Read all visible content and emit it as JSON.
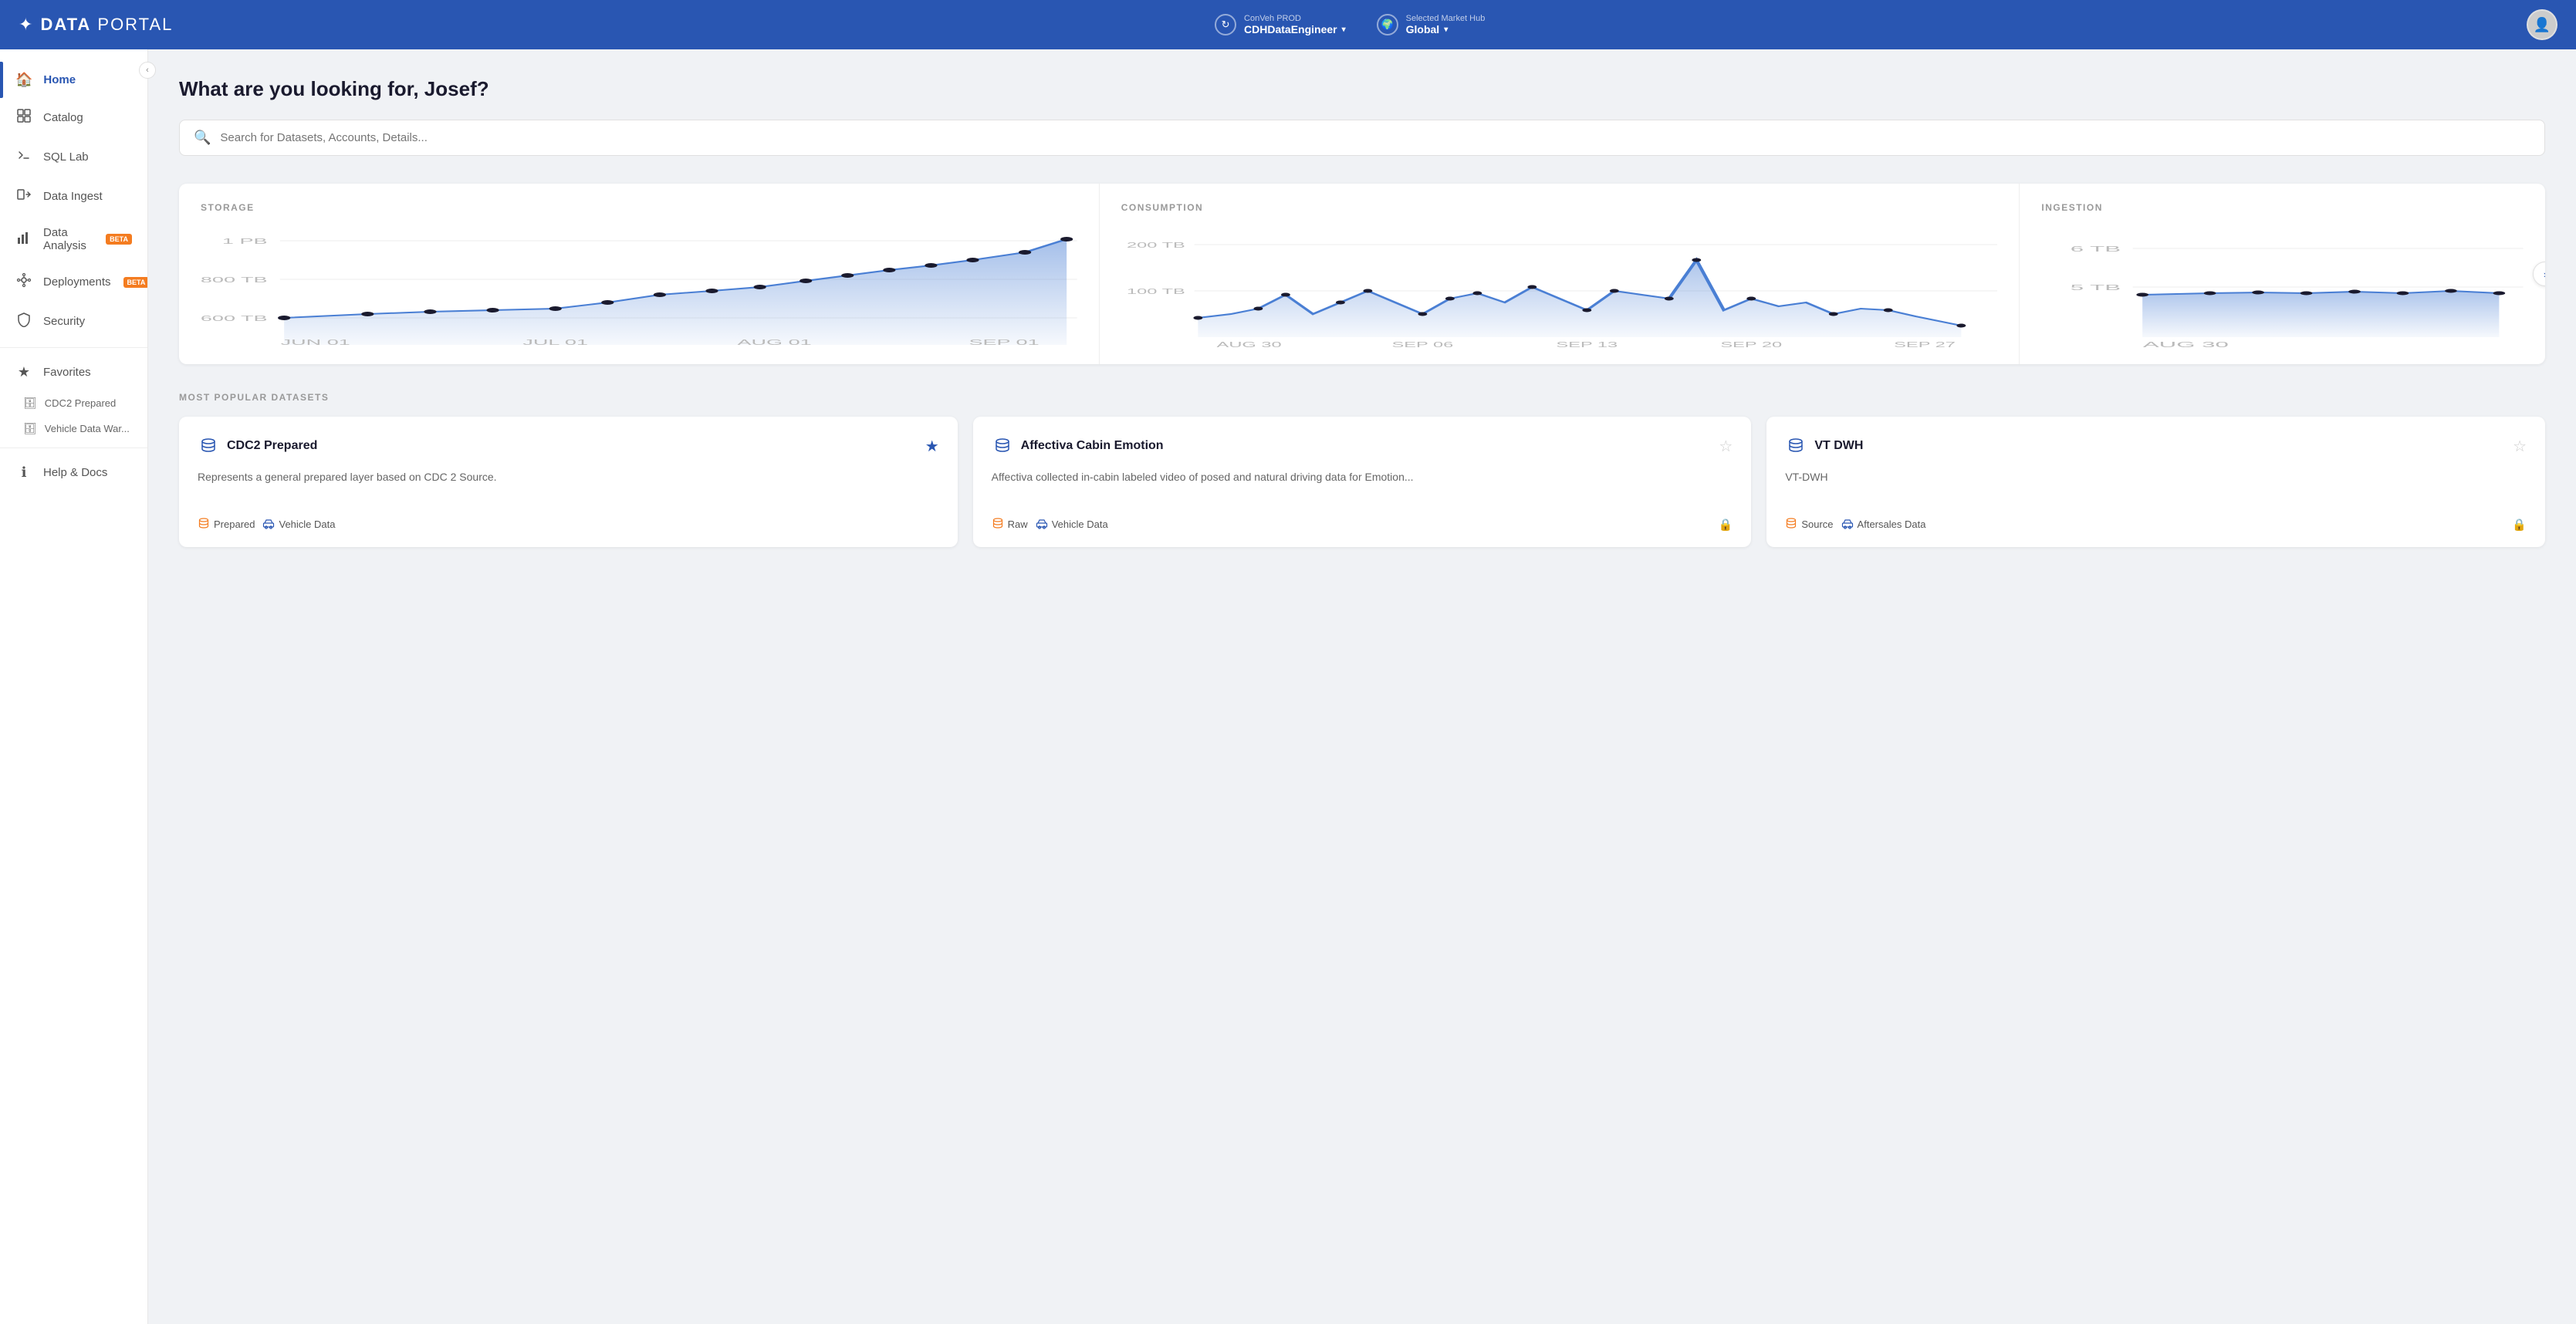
{
  "header": {
    "logo_bold": "DATA",
    "logo_thin": " PORTAL",
    "env": {
      "label": "ConVeh PROD",
      "value": "CDHDataEngineer"
    },
    "market": {
      "label": "Selected Market Hub",
      "value": "Global"
    }
  },
  "sidebar": {
    "collapse_icon": "‹",
    "items": [
      {
        "id": "home",
        "label": "Home",
        "icon": "🏠",
        "active": true,
        "badge": null
      },
      {
        "id": "catalog",
        "label": "Catalog",
        "icon": "⊞",
        "active": false,
        "badge": null
      },
      {
        "id": "sql-lab",
        "label": "SQL Lab",
        "icon": "⚡",
        "active": false,
        "badge": null
      },
      {
        "id": "data-ingest",
        "label": "Data Ingest",
        "icon": "→⊡",
        "active": false,
        "badge": null
      },
      {
        "id": "data-analysis",
        "label": "Data Analysis",
        "icon": "📊",
        "active": false,
        "badge": "BETA"
      },
      {
        "id": "deployments",
        "label": "Deployments",
        "icon": "🔧",
        "active": false,
        "badge": "BETA"
      },
      {
        "id": "security",
        "label": "Security",
        "icon": "🛡",
        "active": false,
        "badge": null
      }
    ],
    "favorites_label": "Favorites",
    "favorites_icon": "★",
    "favorites_items": [
      {
        "id": "cdc2",
        "label": "CDC2 Prepared",
        "icon": "🗄"
      },
      {
        "id": "vehicle",
        "label": "Vehicle Data War...",
        "icon": "🗄"
      }
    ],
    "help_label": "Help & Docs",
    "help_icon": "ℹ"
  },
  "main": {
    "heading": "What are you looking for, Josef?",
    "search_placeholder": "Search for Datasets, Accounts, Details...",
    "charts": {
      "storage": {
        "title": "STORAGE",
        "y_labels": [
          "1 PB",
          "800 TB",
          "600 TB"
        ],
        "x_labels": [
          "JUN 01",
          "JUL 01",
          "AUG 01",
          "SEP 01"
        ]
      },
      "consumption": {
        "title": "CONSUMPTION",
        "y_labels": [
          "200 TB",
          "100 TB"
        ],
        "x_labels": [
          "AUG 30",
          "SEP 06",
          "SEP 13",
          "SEP 20",
          "SEP 27"
        ]
      },
      "ingestion": {
        "title": "INGESTION",
        "y_labels": [
          "6 TB",
          "5 TB"
        ],
        "x_labels": [
          "AUG 30"
        ]
      }
    },
    "datasets_section_title": "MOST POPULAR DATASETS",
    "datasets": [
      {
        "id": "cdc2",
        "name": "CDC2 Prepared",
        "icon": "🗄",
        "description": "Represents a general prepared layer based on CDC 2 Source.",
        "favorited": true,
        "tags": [
          {
            "label": "Prepared",
            "color": "orange"
          },
          {
            "label": "Vehicle Data",
            "color": "blue"
          }
        ],
        "locked": false
      },
      {
        "id": "affectiva",
        "name": "Affectiva Cabin Emotion",
        "icon": "🗄",
        "description": "Affectiva collected in-cabin labeled video of posed and natural driving data for Emotion...",
        "favorited": false,
        "tags": [
          {
            "label": "Raw",
            "color": "orange"
          },
          {
            "label": "Vehicle Data",
            "color": "blue"
          }
        ],
        "locked": true
      },
      {
        "id": "vt-dwh",
        "name": "VT DWH",
        "icon": "🗄",
        "description": "VT-DWH",
        "favorited": false,
        "tags": [
          {
            "label": "Source",
            "color": "orange"
          },
          {
            "label": "Aftersales Data",
            "color": "blue"
          }
        ],
        "locked": true
      }
    ]
  }
}
